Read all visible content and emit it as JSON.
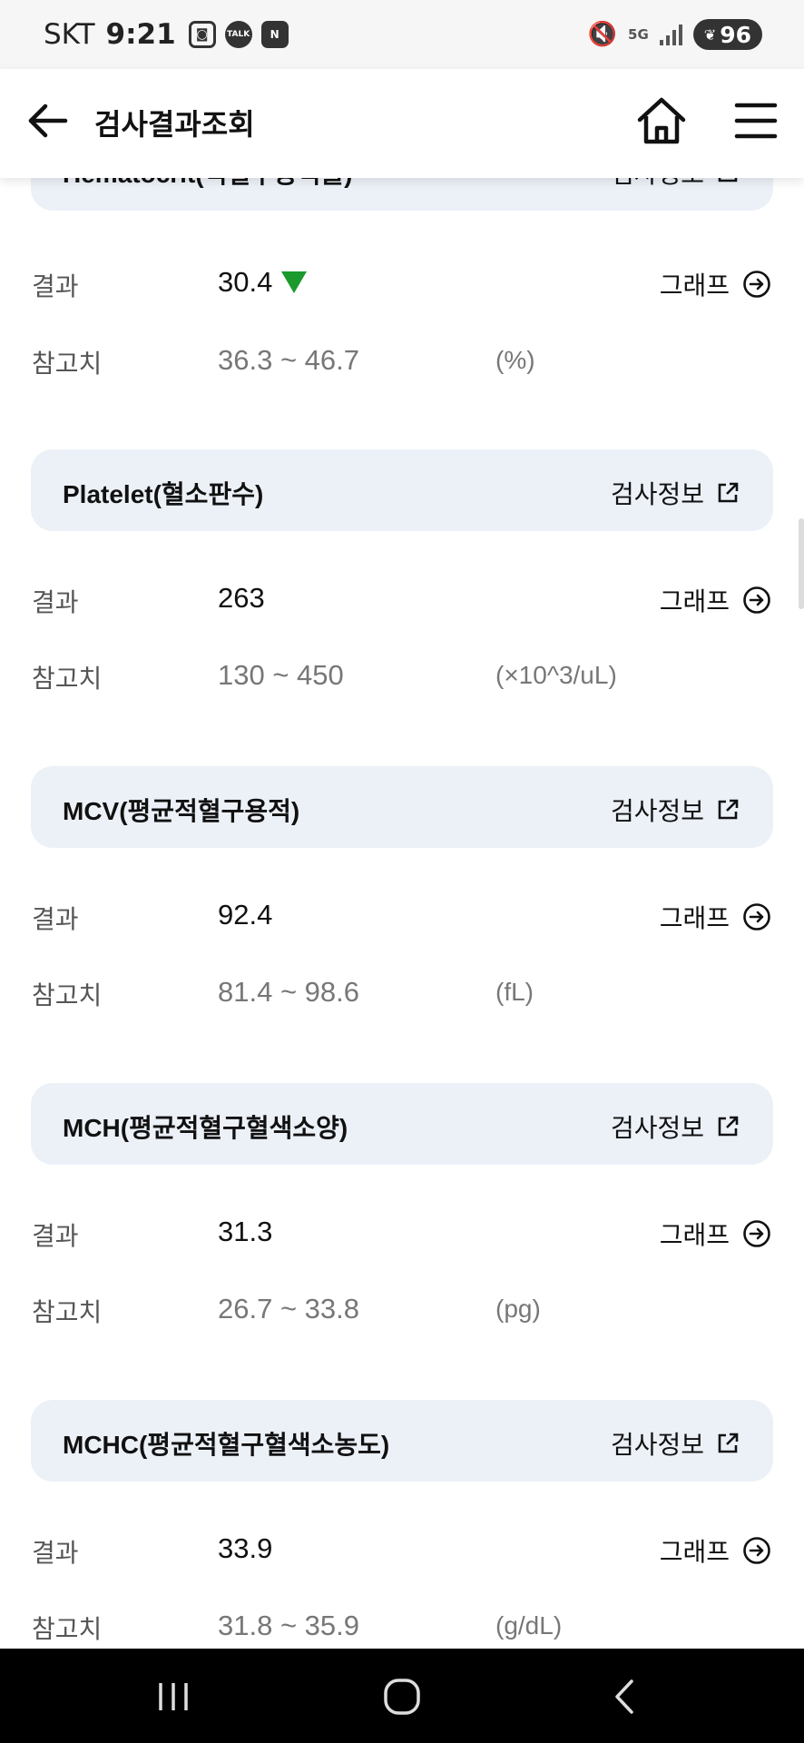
{
  "status_bar": {
    "carrier": "SKT",
    "time": "9:21",
    "talk_badge": "TALK",
    "n_badge": "N",
    "network": "5G",
    "battery": "96"
  },
  "header": {
    "title": "검사결과조회"
  },
  "labels": {
    "result": "결과",
    "reference": "참고치",
    "info_link": "검사정보",
    "graph_link": "그래프"
  },
  "tests": [
    {
      "name": "Hematocrit(적혈구용적률)",
      "result": "30.4",
      "flag": "low",
      "reference": "36.3 ~ 46.7",
      "unit": "(%)"
    },
    {
      "name": "Platelet(혈소판수)",
      "result": "263",
      "reference": "130 ~ 450",
      "unit": "(×10^3/uL)"
    },
    {
      "name": "MCV(평균적혈구용적)",
      "result": "92.4",
      "reference": "81.4 ~ 98.6",
      "unit": "(fL)"
    },
    {
      "name": "MCH(평균적혈구혈색소양)",
      "result": "31.3",
      "reference": "26.7 ~ 33.8",
      "unit": "(pg)"
    },
    {
      "name": "MCHC(평균적혈구혈색소농도)",
      "result": "33.9",
      "reference": "31.8 ~ 35.9",
      "unit": "(g/dL)"
    }
  ],
  "colors": {
    "accent_low": "#1a9a2c",
    "card_bg": "#ecf1f8"
  }
}
